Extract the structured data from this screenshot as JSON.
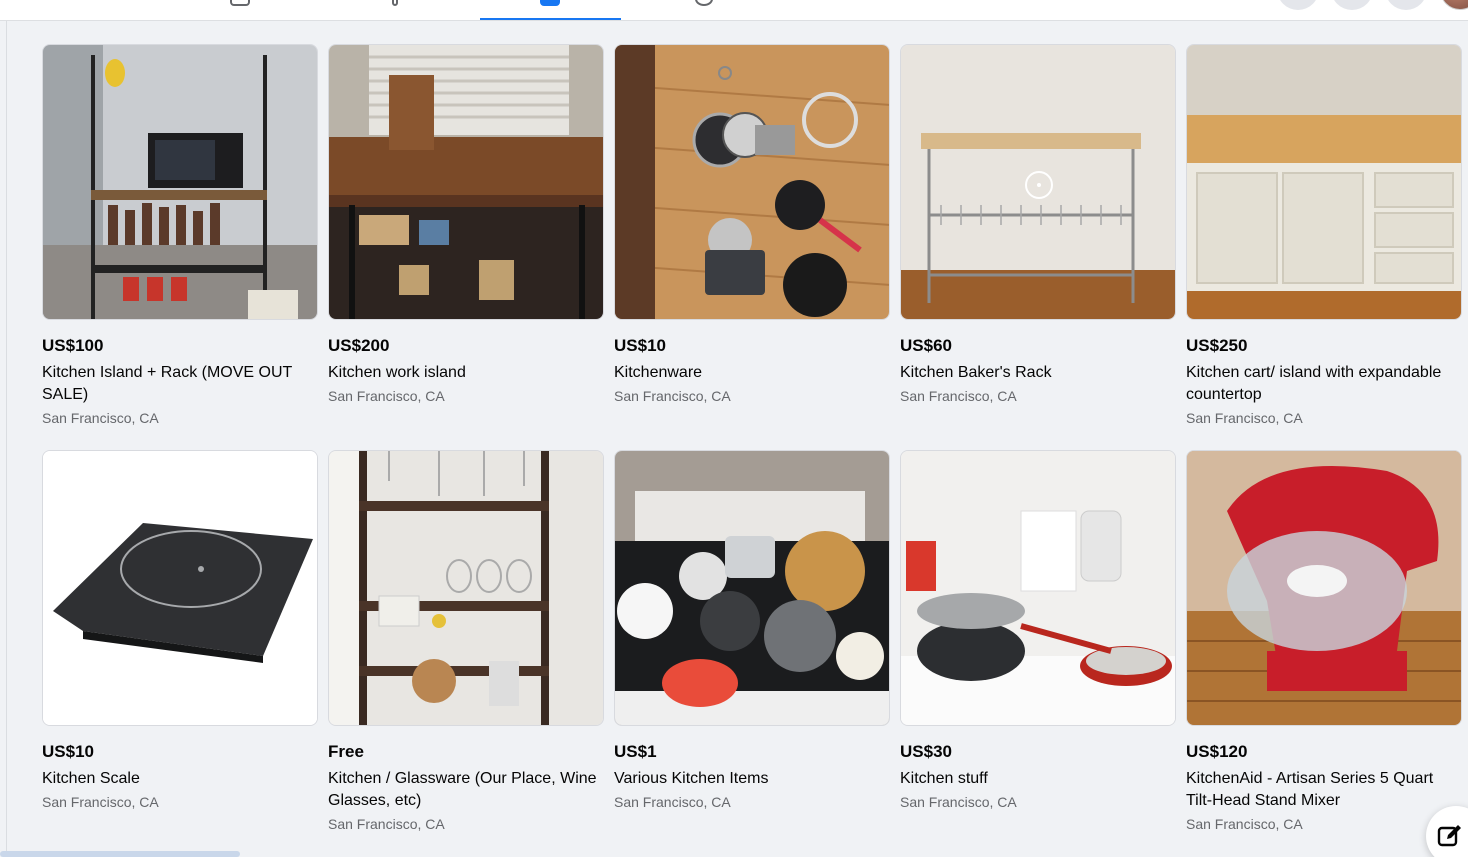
{
  "listings": [
    {
      "price": "US$100",
      "title": "Kitchen Island + Rack (MOVE OUT SALE)",
      "location": "San Francisco, CA"
    },
    {
      "price": "US$200",
      "title": "Kitchen work island",
      "location": "San Francisco, CA"
    },
    {
      "price": "US$10",
      "title": "Kitchenware",
      "location": "San Francisco, CA"
    },
    {
      "price": "US$60",
      "title": "Kitchen Baker's Rack",
      "location": "San Francisco, CA"
    },
    {
      "price": "US$250",
      "title": "Kitchen cart/ island with expandable countertop",
      "location": "San Francisco, CA"
    },
    {
      "price": "US$10",
      "title": "Kitchen Scale",
      "location": "San Francisco, CA"
    },
    {
      "price": "Free",
      "title": "Kitchen / Glassware (Our Place, Wine Glasses, etc)",
      "location": "San Francisco, CA"
    },
    {
      "price": "US$1",
      "title": "Various Kitchen Items",
      "location": "San Francisco, CA"
    },
    {
      "price": "US$30",
      "title": "Kitchen stuff",
      "location": "San Francisco, CA"
    },
    {
      "price": "US$120",
      "title": "KitchenAid - Artisan Series 5 Quart Tilt-Head Stand Mixer",
      "location": "San Francisco, CA"
    }
  ],
  "icons": {
    "compose": "edit-icon",
    "nav_tabs": [
      "home-icon",
      "video-icon",
      "marketplace-icon",
      "groups-icon"
    ]
  },
  "colors": {
    "accent": "#1877f2",
    "background": "#f0f2f5",
    "secondary_text": "#65676b"
  }
}
